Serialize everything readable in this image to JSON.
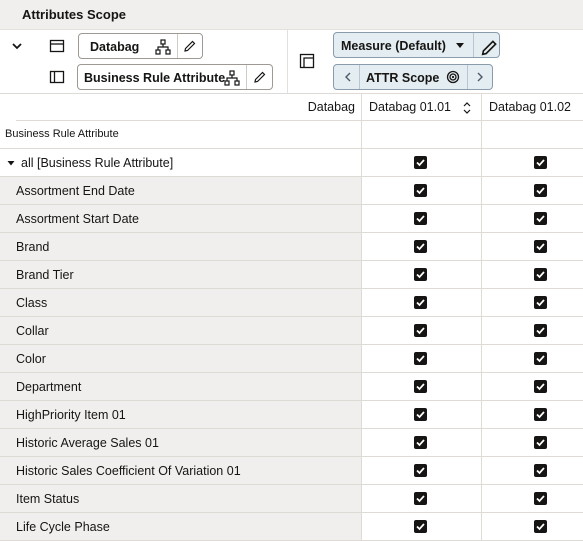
{
  "header": {
    "title": "Attributes Scope"
  },
  "toolbar": {
    "row_dimension": "Databag",
    "column_dimension": "Business Rule Attribute",
    "measure": "Measure (Default)",
    "scope": "ATTR Scope"
  },
  "grid": {
    "column_dimension_label": "Databag",
    "row_dimension_label": "Business Rule Attribute",
    "columns": [
      "Databag 01.01",
      "Databag 01.02"
    ],
    "root_row": "all [Business Rule Attribute]",
    "rows": [
      {
        "label": "Assortment End Date",
        "values": [
          true,
          true
        ]
      },
      {
        "label": "Assortment Start Date",
        "values": [
          true,
          true
        ]
      },
      {
        "label": "Brand",
        "values": [
          true,
          true
        ]
      },
      {
        "label": "Brand Tier",
        "values": [
          true,
          true
        ]
      },
      {
        "label": "Class",
        "values": [
          true,
          true
        ]
      },
      {
        "label": "Collar",
        "values": [
          true,
          true
        ]
      },
      {
        "label": "Color",
        "values": [
          true,
          true
        ]
      },
      {
        "label": "Department",
        "values": [
          true,
          true
        ]
      },
      {
        "label": "HighPriority Item 01",
        "values": [
          true,
          true
        ]
      },
      {
        "label": "Historic Average Sales 01",
        "values": [
          true,
          true
        ]
      },
      {
        "label": "Historic Sales Coefficient Of Variation 01",
        "values": [
          true,
          true
        ]
      },
      {
        "label": "Item Status",
        "values": [
          true,
          true
        ]
      },
      {
        "label": "Life Cycle Phase",
        "values": [
          true,
          true
        ]
      }
    ],
    "root_values": [
      true,
      true
    ]
  }
}
